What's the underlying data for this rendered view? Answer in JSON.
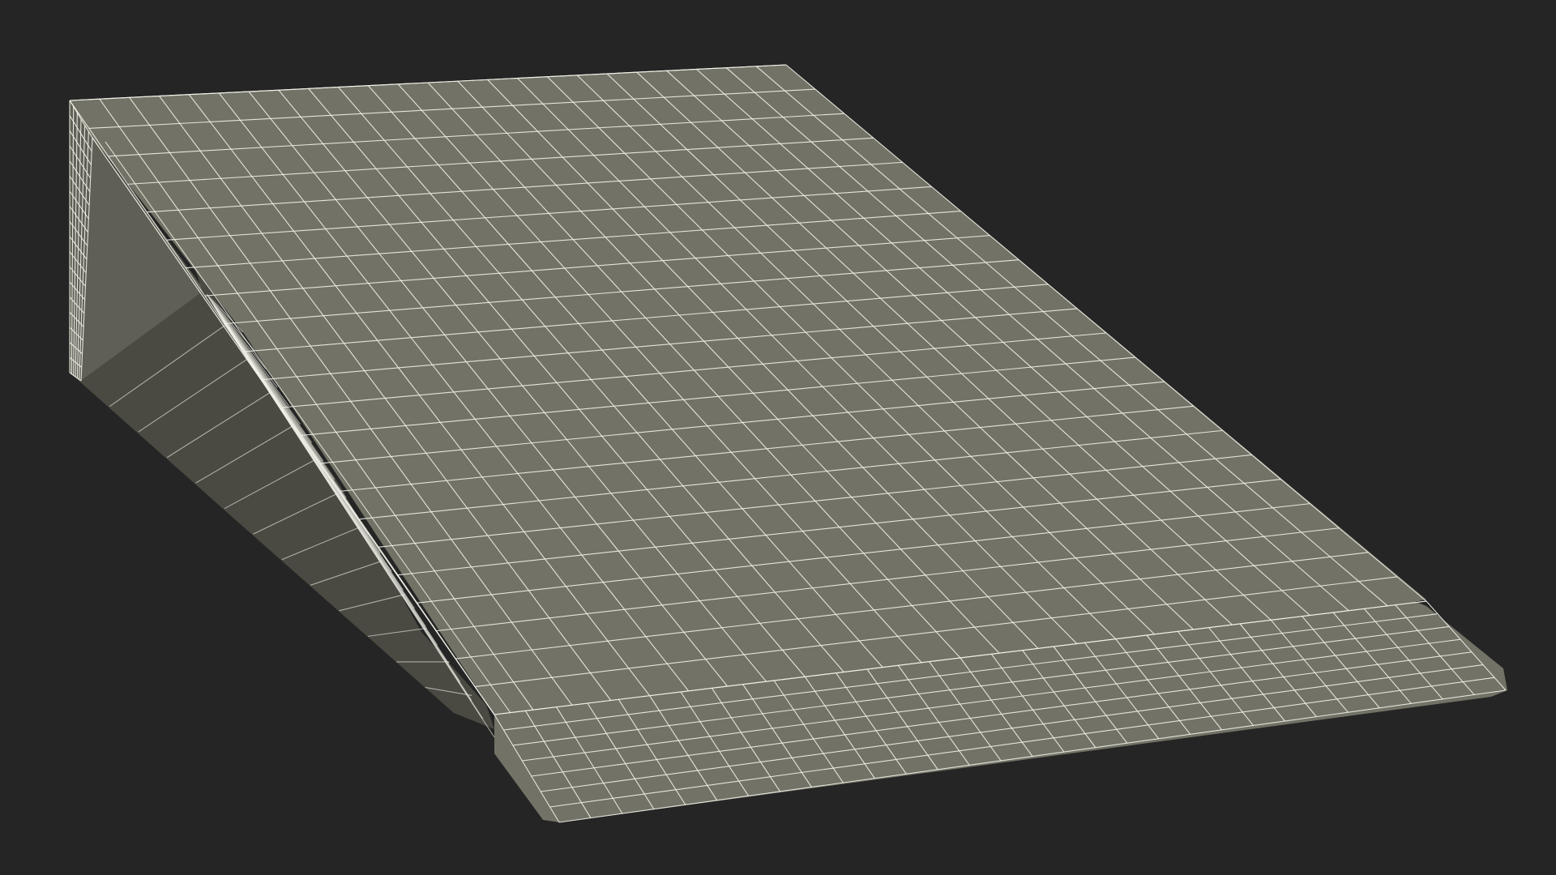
{
  "scene": {
    "background_color": "#252525",
    "mesh_fill_color": "#727266",
    "mesh_side_fill_color": "#5f5f55",
    "mesh_shadow_color": "#4a4a42",
    "wireframe_color": "#f2f2ea",
    "object": "wedge-cushion-wireframe"
  }
}
